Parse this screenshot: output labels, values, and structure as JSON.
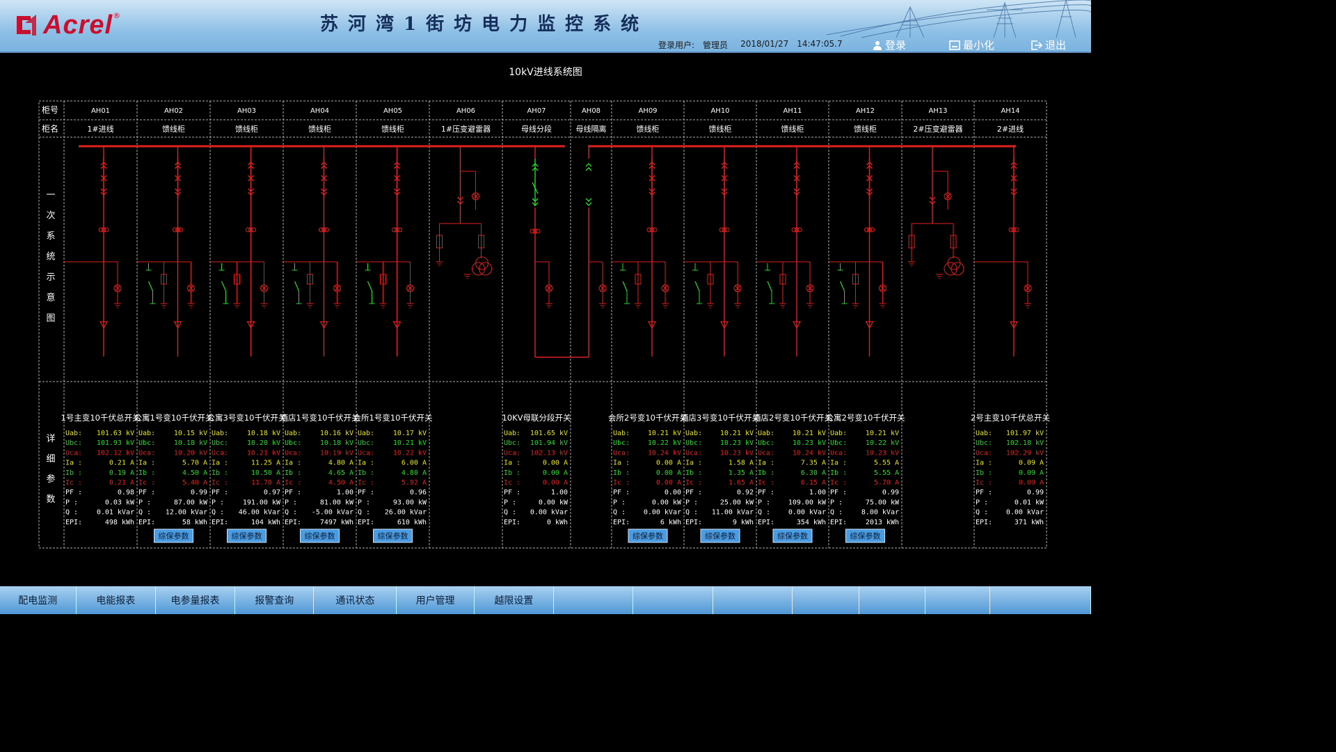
{
  "header": {
    "brand": "Acrel",
    "brand_mark": "®",
    "title": "苏河湾1街坊电力监控系统",
    "user_label": "登录用户:",
    "user_name": "管理员",
    "date": "2018/01/27",
    "time": "14:47:05.7",
    "login_label": "登录",
    "minimize_label": "最小化",
    "exit_label": "退出"
  },
  "diagram": {
    "title": "10kV进线系统图",
    "row_label_no": "柜号",
    "row_label_name": "柜名",
    "side_label_primary": [
      "一",
      "次",
      "系",
      "统",
      "示",
      "意",
      "图"
    ],
    "side_label_detail": [
      "详",
      "细",
      "参",
      "数"
    ],
    "protect_button": "综保参数",
    "cabinets": [
      {
        "no": "AH01",
        "name": "1#进线",
        "type": "incoming",
        "title": "1号主变10千伏总开关",
        "params": {
          "Uab": "101.63 kV",
          "Ubc": "101.93 kV",
          "Uca": "102.12 kV",
          "Ia": "0.21 A",
          "Ib": "0.19 A",
          "Ic": "0.21 A",
          "PF": "0.98",
          "P": "0.03 kW",
          "Q": "0.01 kVar",
          "EPI": "498 kWh"
        },
        "protect": false
      },
      {
        "no": "AH02",
        "name": "馈线柜",
        "type": "feeder",
        "title": "公寓1号变10千伏开关",
        "params": {
          "Uab": "10.15 kV",
          "Ubc": "10.18 kV",
          "Uca": "10.20 kV",
          "Ia": "5.70 A",
          "Ib": "4.50 A",
          "Ic": "5.40 A",
          "PF": "0.99",
          "P": "87.00 kW",
          "Q": "12.00 kVar",
          "EPI": "58 kWh"
        },
        "protect": true
      },
      {
        "no": "AH03",
        "name": "馈线柜",
        "type": "feeder",
        "title": "公寓3号变10千伏开关",
        "params": {
          "Uab": "10.18 kV",
          "Ubc": "10.20 kV",
          "Uca": "10.21 kV",
          "Ia": "11.25 A",
          "Ib": "10.50 A",
          "Ic": "11.70 A",
          "PF": "0.97",
          "P": "191.00 kW",
          "Q": "46.00 kVar",
          "EPI": "104 kWh"
        },
        "protect": true
      },
      {
        "no": "AH04",
        "name": "馈线柜",
        "type": "feeder",
        "title": "酒店1号变10千伏开关",
        "params": {
          "Uab": "10.16 kV",
          "Ubc": "10.18 kV",
          "Uca": "10.19 kV",
          "Ia": "4.80 A",
          "Ib": "4.65 A",
          "Ic": "4.50 A",
          "PF": "1.00",
          "P": "81.00 kW",
          "Q": "-5.00 kVar",
          "EPI": "7497 kWh"
        },
        "protect": true
      },
      {
        "no": "AH05",
        "name": "馈线柜",
        "type": "feeder",
        "title": "会所1号变10千伏开关",
        "params": {
          "Uab": "10.17 kV",
          "Ubc": "10.21 kV",
          "Uca": "10.22 kV",
          "Ia": "6.00 A",
          "Ib": "4.80 A",
          "Ic": "5.92 A",
          "PF": "0.96",
          "P": "93.00 kW",
          "Q": "26.00 kVar",
          "EPI": "610 kWh"
        },
        "protect": true
      },
      {
        "no": "AH06",
        "name": "1#压变避雷器",
        "type": "pt",
        "title": "",
        "params": null,
        "protect": false
      },
      {
        "no": "AH07",
        "name": "母线分段",
        "type": "tie",
        "title": "10KV母联分段开关",
        "params": {
          "Uab": "101.65 kV",
          "Ubc": "101.94 kV",
          "Uca": "102.13 kV",
          "Ia": "0.00 A",
          "Ib": "0.00 A",
          "Ic": "0.00 A",
          "PF": "1.00",
          "P": "0.00 kW",
          "Q": "0.00 kVar",
          "EPI": "0 kWh"
        },
        "protect": false
      },
      {
        "no": "AH08",
        "name": "母线隔离",
        "type": "isolator",
        "title": "",
        "params": null,
        "protect": false
      },
      {
        "no": "AH09",
        "name": "馈线柜",
        "type": "feeder",
        "title": "会所2号变10千伏开关",
        "params": {
          "Uab": "10.21 kV",
          "Ubc": "10.22 kV",
          "Uca": "10.24 kV",
          "Ia": "0.00 A",
          "Ib": "0.00 A",
          "Ic": "0.00 A",
          "PF": "0.00",
          "P": "0.00 kW",
          "Q": "0.00 kVar",
          "EPI": "6 kWh"
        },
        "protect": true
      },
      {
        "no": "AH10",
        "name": "馈线柜",
        "type": "feeder",
        "title": "酒店3号变10千伏开关",
        "params": {
          "Uab": "10.21 kV",
          "Ubc": "10.23 kV",
          "Uca": "10.23 kV",
          "Ia": "1.58 A",
          "Ib": "1.35 A",
          "Ic": "1.65 A",
          "PF": "0.92",
          "P": "25.00 kW",
          "Q": "11.00 kVar",
          "EPI": "9 kWh"
        },
        "protect": true
      },
      {
        "no": "AH11",
        "name": "馈线柜",
        "type": "feeder",
        "title": "酒店2号变10千伏开关",
        "params": {
          "Uab": "10.21 kV",
          "Ubc": "10.23 kV",
          "Uca": "10.24 kV",
          "Ia": "7.35 A",
          "Ib": "6.30 A",
          "Ic": "6.15 A",
          "PF": "1.00",
          "P": "109.00 kW",
          "Q": "0.00 kVar",
          "EPI": "354 kWh"
        },
        "protect": true
      },
      {
        "no": "AH12",
        "name": "馈线柜",
        "type": "feeder",
        "title": "公寓2号变10千伏开关",
        "params": {
          "Uab": "10.21 kV",
          "Ubc": "10.22 kV",
          "Uca": "10.23 kV",
          "Ia": "5.55 A",
          "Ib": "5.55 A",
          "Ic": "5.70 A",
          "PF": "0.99",
          "P": "75.00 kW",
          "Q": "8.00 kVar",
          "EPI": "2013 kWh"
        },
        "protect": true
      },
      {
        "no": "AH13",
        "name": "2#压变避雷器",
        "type": "pt",
        "title": "",
        "params": null,
        "protect": false
      },
      {
        "no": "AH14",
        "name": "2#进线",
        "type": "incoming",
        "title": "2号主变10千伏总开关",
        "params": {
          "Uab": "101.97 kV",
          "Ubc": "102.18 kV",
          "Uca": "102.29 kV",
          "Ia": "0.09 A",
          "Ib": "0.09 A",
          "Ic": "0.09 A",
          "PF": "0.99",
          "P": "0.01 kW",
          "Q": "0.00 kVar",
          "EPI": "371 kWh"
        },
        "protect": false
      }
    ],
    "param_labels": {
      "Uab": "Uab:",
      "Ubc": "Ubc:",
      "Uca": "Uca:",
      "Ia": "Ia :",
      "Ib": "Ib :",
      "Ic": "Ic :",
      "PF": "PF :",
      "P": "P :",
      "Q": "Q :",
      "EPI": "EPI:"
    }
  },
  "colors": {
    "bus": "#e0201e",
    "energized": "#e0201e",
    "deenergized": "#1ee01e",
    "grid": "#b0b0b0",
    "phaseA": "#e8e800",
    "phaseB": "#1ee01e",
    "phaseC": "#e0201e",
    "text": "#ffffff"
  },
  "nav": {
    "tabs": [
      "配电监测",
      "电能报表",
      "电参量报表",
      "报警查询",
      "通讯状态",
      "用户管理",
      "越限设置",
      "",
      "",
      "",
      "",
      "",
      "",
      ""
    ]
  }
}
